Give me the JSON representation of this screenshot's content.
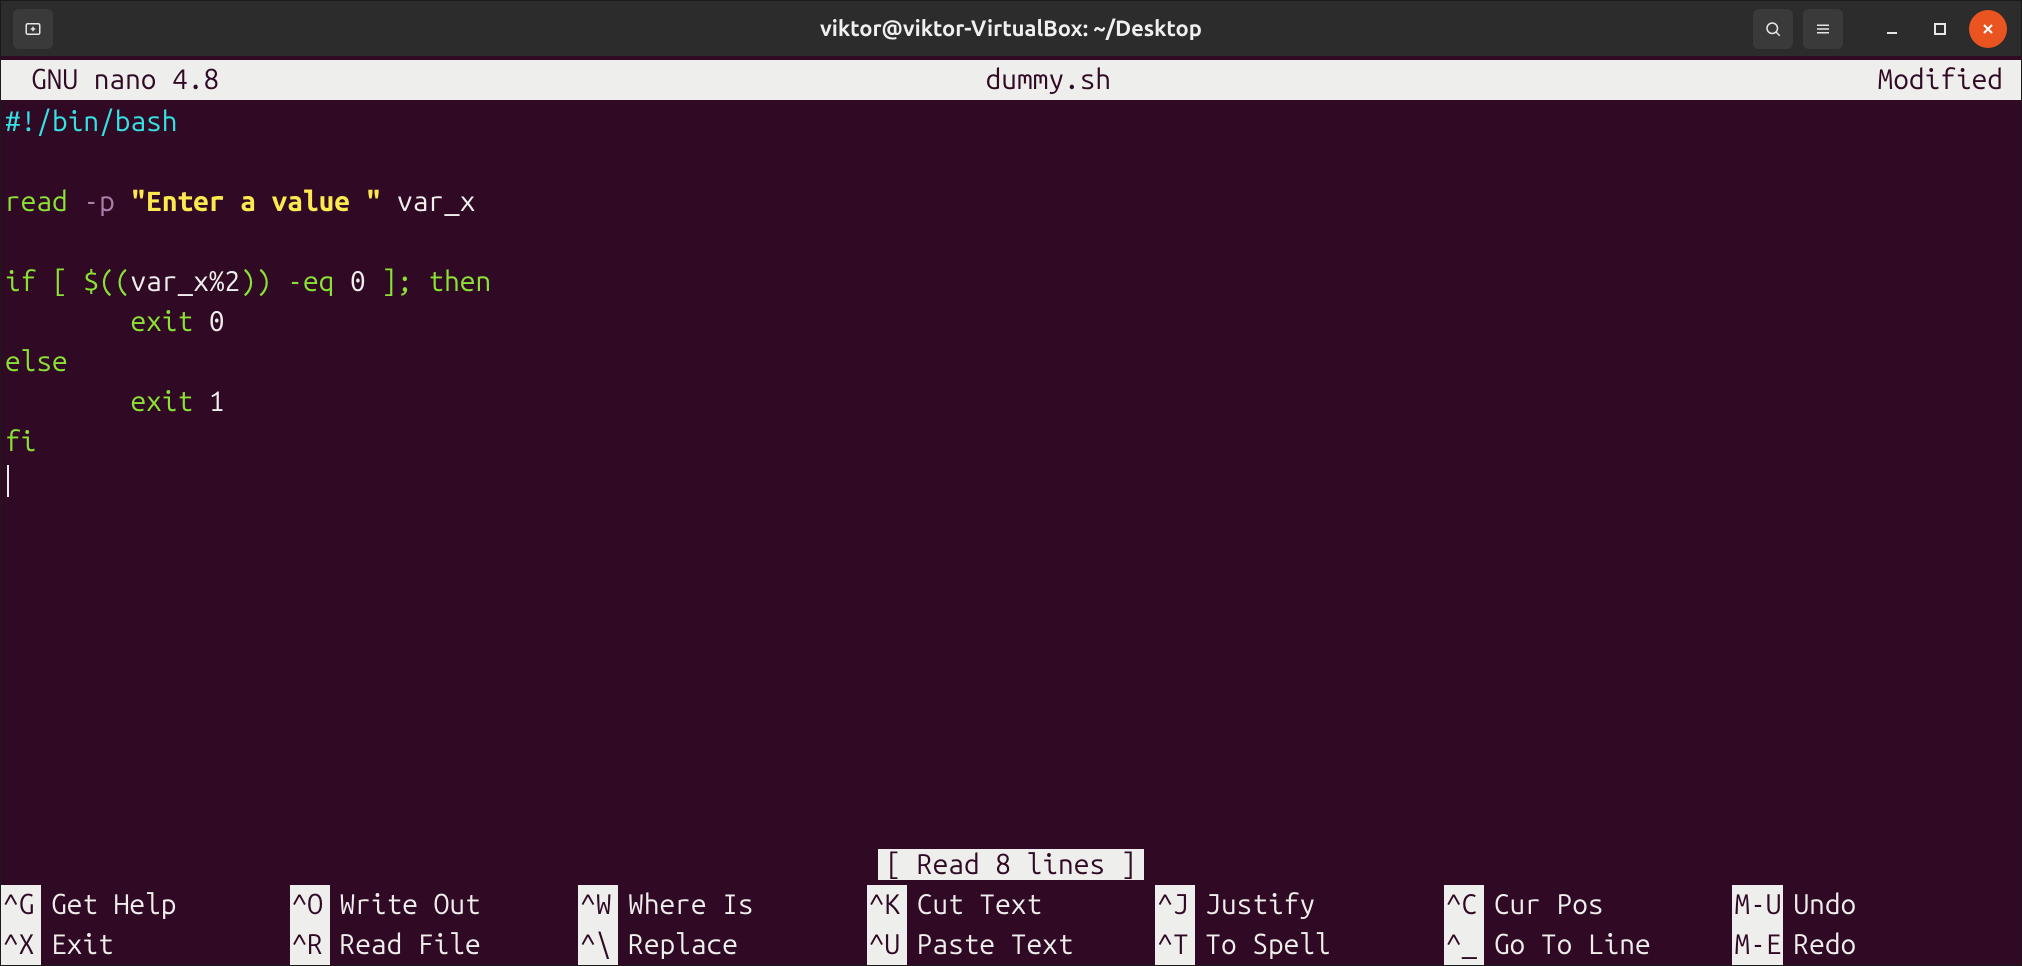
{
  "titlebar": {
    "title": "viktor@viktor-VirtualBox: ~/Desktop"
  },
  "nano": {
    "version": "GNU nano 4.8",
    "filename": "dummy.sh",
    "status": "Modified",
    "message": "[ Read 8 lines ]"
  },
  "code": {
    "l1_shebang": "#!/bin/bash",
    "l3_read": "read",
    "l3_flag": " -p",
    "l3_str": " \"Enter a value \"",
    "l3_var": " var_x",
    "l5_if": "if",
    "l5_cond1": " [ $((",
    "l5_cond2": "var_x%2",
    "l5_cond3": ")) -eq ",
    "l5_zero": "0",
    "l5_cond4": " ]; ",
    "l5_then": "then",
    "l6_exit": "        exit",
    "l6_val": " 0",
    "l7_else": "else",
    "l8_exit": "        exit",
    "l8_val": " 1",
    "l9_fi": "fi"
  },
  "shortcuts": [
    {
      "key": "^G",
      "label": "Get Help"
    },
    {
      "key": "^O",
      "label": "Write Out"
    },
    {
      "key": "^W",
      "label": "Where Is"
    },
    {
      "key": "^K",
      "label": "Cut Text"
    },
    {
      "key": "^J",
      "label": "Justify"
    },
    {
      "key": "^C",
      "label": "Cur Pos"
    },
    {
      "key": "M-U",
      "label": "Undo"
    },
    {
      "key": "^X",
      "label": "Exit"
    },
    {
      "key": "^R",
      "label": "Read File"
    },
    {
      "key": "^\\",
      "label": "Replace"
    },
    {
      "key": "^U",
      "label": "Paste Text"
    },
    {
      "key": "^T",
      "label": "To Spell"
    },
    {
      "key": "^_",
      "label": "Go To Line"
    },
    {
      "key": "M-E",
      "label": "Redo"
    }
  ]
}
